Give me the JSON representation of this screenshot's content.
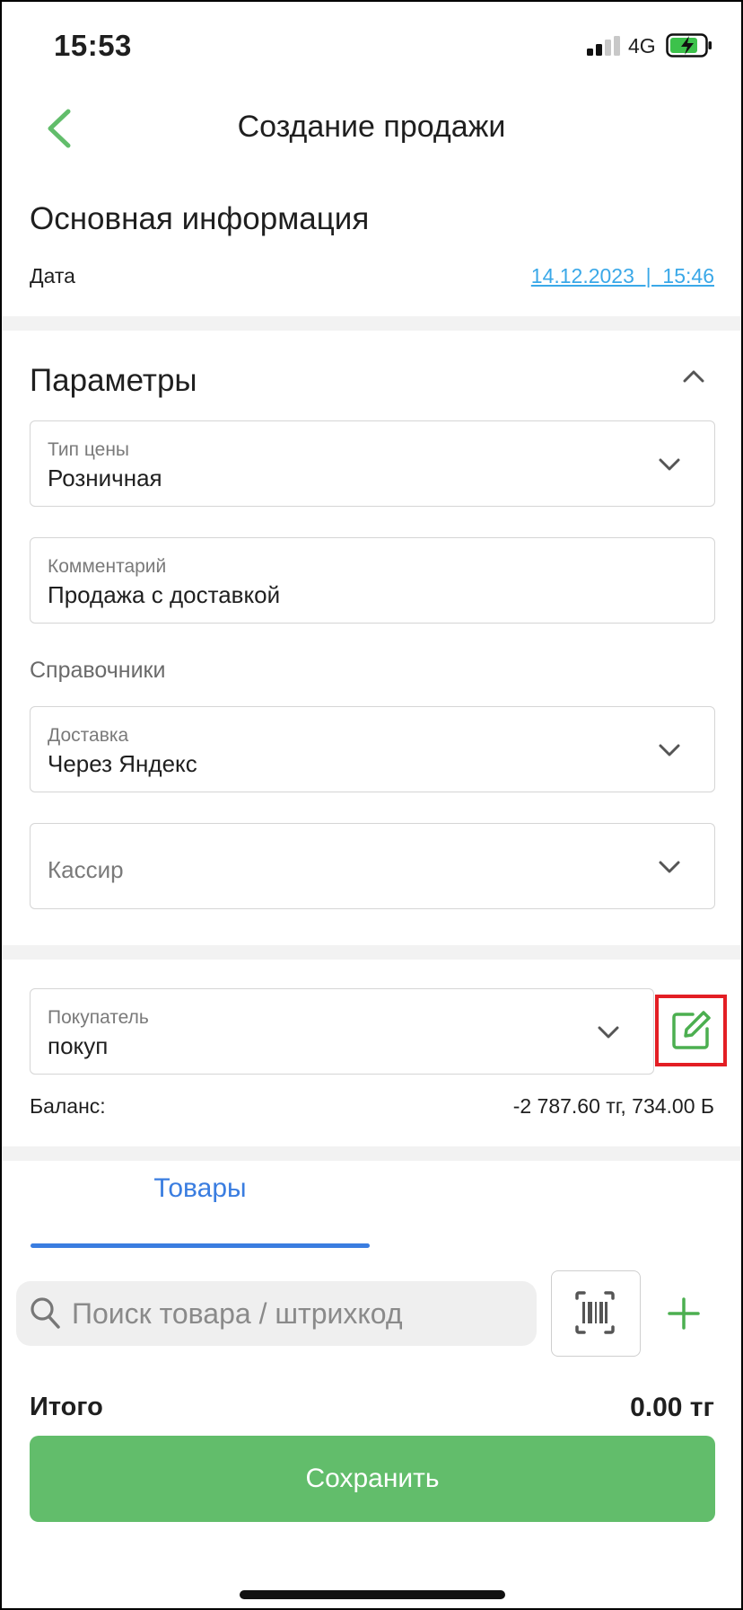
{
  "status_bar": {
    "time": "15:53",
    "network": "4G"
  },
  "header": {
    "title": "Создание продажи"
  },
  "basic_info": {
    "heading": "Основная информация",
    "date_label": "Дата",
    "date_value": "14.12.2023  |  15:46"
  },
  "params": {
    "heading": "Параметры",
    "price_type": {
      "label": "Тип цены",
      "value": "Розничная"
    },
    "comment": {
      "label": "Комментарий",
      "value": "Продажа с доставкой"
    },
    "directories_caption": "Справочники",
    "delivery": {
      "label": "Доставка",
      "value": "Через Яндекс"
    },
    "cashier": {
      "placeholder": "Кассир"
    }
  },
  "buyer": {
    "label": "Покупатель",
    "value": "покуп",
    "balance_label": "Баланс:",
    "balance_value": "-2 787.60 тг, 734.00 Б"
  },
  "tabs": {
    "goods": "Товары"
  },
  "search": {
    "placeholder": "Поиск товара / штрихкод"
  },
  "total": {
    "label": "Итого",
    "value": "0.00 тг"
  },
  "save_button": "Сохранить",
  "colors": {
    "accent_green": "#62bd6b",
    "link_blue": "#3aa8e8",
    "tab_blue": "#3a7de0",
    "highlight_red": "#e31e24"
  },
  "icons": [
    "back-chevron-icon",
    "chevron-up-icon",
    "chevron-down-icon",
    "edit-icon",
    "search-icon",
    "barcode-icon",
    "plus-icon"
  ]
}
